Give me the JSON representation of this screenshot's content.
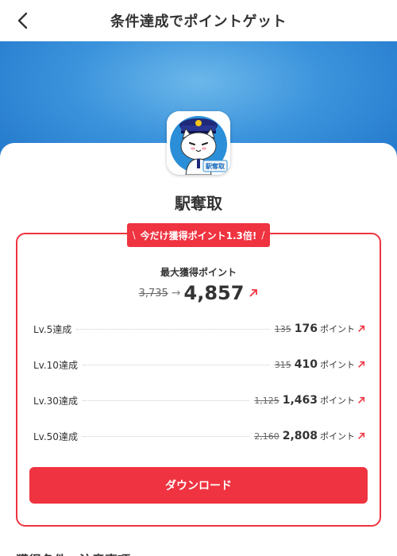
{
  "header": {
    "title": "条件達成でポイントゲット"
  },
  "app": {
    "name": "駅奪取",
    "icon_badge": "駅奪取"
  },
  "promo": {
    "left": "\\",
    "text": "今だけ獲得ポイント1.3倍!",
    "right": "/"
  },
  "max_points": {
    "label": "最大獲得ポイント",
    "old": "3,735",
    "arrow": "→",
    "new": "4,857"
  },
  "levels": [
    {
      "label": "Lv.5達成",
      "old": "135",
      "new": "176",
      "unit": "ポイント"
    },
    {
      "label": "Lv.10達成",
      "old": "315",
      "new": "410",
      "unit": "ポイント"
    },
    {
      "label": "Lv.30達成",
      "old": "1,125",
      "new": "1,463",
      "unit": "ポイント"
    },
    {
      "label": "Lv.50達成",
      "old": "2,160",
      "new": "2,808",
      "unit": "ポイント"
    }
  ],
  "download": {
    "label": "ダウンロード"
  },
  "section": {
    "title": "獲得条件・注意事項"
  },
  "colors": {
    "accent": "#ef3340",
    "hero": "#3b93dc"
  }
}
